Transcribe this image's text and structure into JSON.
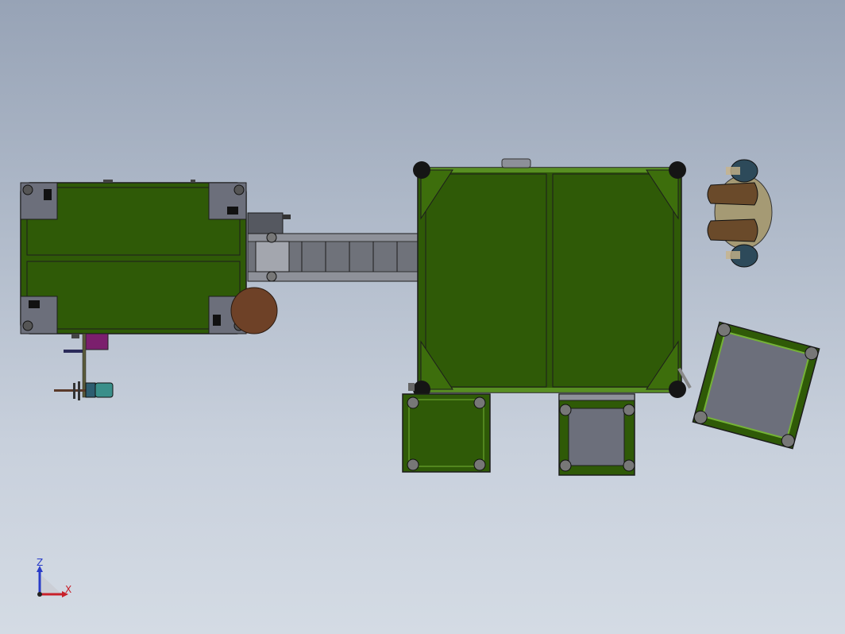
{
  "viewport": {
    "background_top": "#97a3b6",
    "background_bottom": "#d4dbe4"
  },
  "model": {
    "frame_color": "#2f5a07",
    "frame_edge": "#74b236",
    "panel_grey": "#6c6f7b",
    "conveyor_grey": "#8e9199",
    "dark_outline": "#1c1c1c",
    "operator_skin": "#a59a74",
    "operator_hair": "#6a4a2a",
    "motor_color": "#3a8f8a",
    "purple_box": "#7b1f6d"
  },
  "triad": {
    "z_label": "Z",
    "x_label": "X",
    "z_color": "#2a3cc8",
    "x_color": "#c8202a"
  }
}
